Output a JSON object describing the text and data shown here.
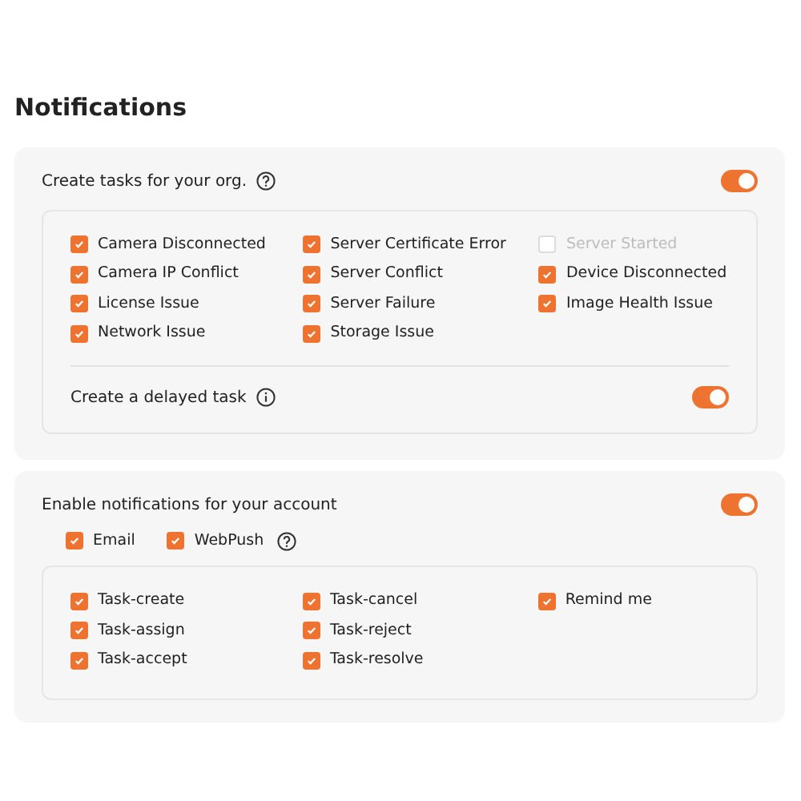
{
  "title": "Notifications",
  "org_tasks": {
    "label": "Create tasks for your org.",
    "on": true,
    "columns": [
      [
        {
          "label": "Camera Disconnected",
          "checked": true,
          "disabled": false
        },
        {
          "label": "Camera IP Conflict",
          "checked": true,
          "disabled": false
        },
        {
          "label": "License Issue",
          "checked": true,
          "disabled": false
        },
        {
          "label": "Network Issue",
          "checked": true,
          "disabled": false
        }
      ],
      [
        {
          "label": "Server Certificate Error",
          "checked": true,
          "disabled": false
        },
        {
          "label": "Server Conflict",
          "checked": true,
          "disabled": false
        },
        {
          "label": "Server Failure",
          "checked": true,
          "disabled": false
        },
        {
          "label": "Storage Issue",
          "checked": true,
          "disabled": false
        }
      ],
      [
        {
          "label": "Server Started",
          "checked": false,
          "disabled": true
        },
        {
          "label": "Device Disconnected",
          "checked": true,
          "disabled": false
        },
        {
          "label": "Image Health Issue",
          "checked": true,
          "disabled": false
        }
      ]
    ],
    "delayed": {
      "label": "Create a delayed task",
      "on": true
    }
  },
  "account": {
    "label": "Enable notifications for your account",
    "on": true,
    "channels": [
      {
        "label": "Email",
        "checked": true,
        "help": false
      },
      {
        "label": "WebPush",
        "checked": true,
        "help": true
      }
    ],
    "columns": [
      [
        {
          "label": "Task-create",
          "checked": true,
          "disabled": false
        },
        {
          "label": "Task-assign",
          "checked": true,
          "disabled": false
        },
        {
          "label": "Task-accept",
          "checked": true,
          "disabled": false
        }
      ],
      [
        {
          "label": "Task-cancel",
          "checked": true,
          "disabled": false
        },
        {
          "label": "Task-reject",
          "checked": true,
          "disabled": false
        },
        {
          "label": "Task-resolve",
          "checked": true,
          "disabled": false
        }
      ],
      [
        {
          "label": "Remind me",
          "checked": true,
          "disabled": false
        }
      ]
    ]
  }
}
